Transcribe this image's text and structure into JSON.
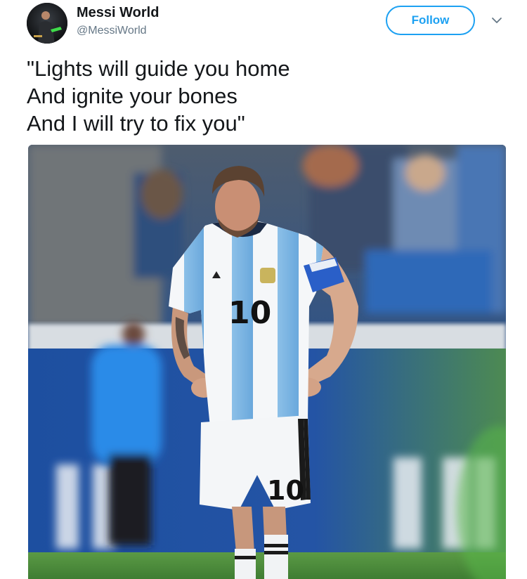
{
  "tweet": {
    "author": {
      "display_name": "Messi World",
      "handle": "@MessiWorld",
      "avatar_icon": "avatar-photo"
    },
    "follow_label": "Follow",
    "menu_icon": "chevron-down-icon",
    "text_lines": [
      "\"Lights will guide you home",
      "And ignite your bones",
      "And I will try to fix you\""
    ],
    "media": {
      "jersey_number": "10",
      "shorts_number": "10"
    }
  },
  "colors": {
    "brand_blue": "#1da1f2",
    "text_primary": "#14171a",
    "text_secondary": "#657786"
  }
}
